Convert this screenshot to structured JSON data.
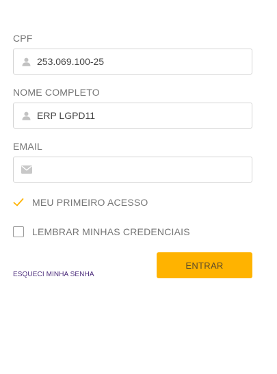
{
  "colors": {
    "accent": "#ffb300",
    "link": "#4a2a7a",
    "label": "#757575",
    "border": "#d4d4d4"
  },
  "cpf": {
    "label": "CPF",
    "value": "253.069.100-25",
    "icon": "user-icon"
  },
  "nome": {
    "label": "NOME COMPLETO",
    "value": "ERP LGPD11",
    "icon": "user-icon"
  },
  "email": {
    "label": "EMAIL",
    "value": "",
    "icon": "envelope-icon"
  },
  "primeiro_acesso": {
    "label": "MEU PRIMEIRO ACESSO",
    "checked": true
  },
  "lembrar": {
    "label": "LEMBRAR MINHAS CREDENCIAIS",
    "checked": false
  },
  "actions": {
    "forgot_label": "ESQUECI MINHA SENHA",
    "submit_label": "ENTRAR"
  }
}
